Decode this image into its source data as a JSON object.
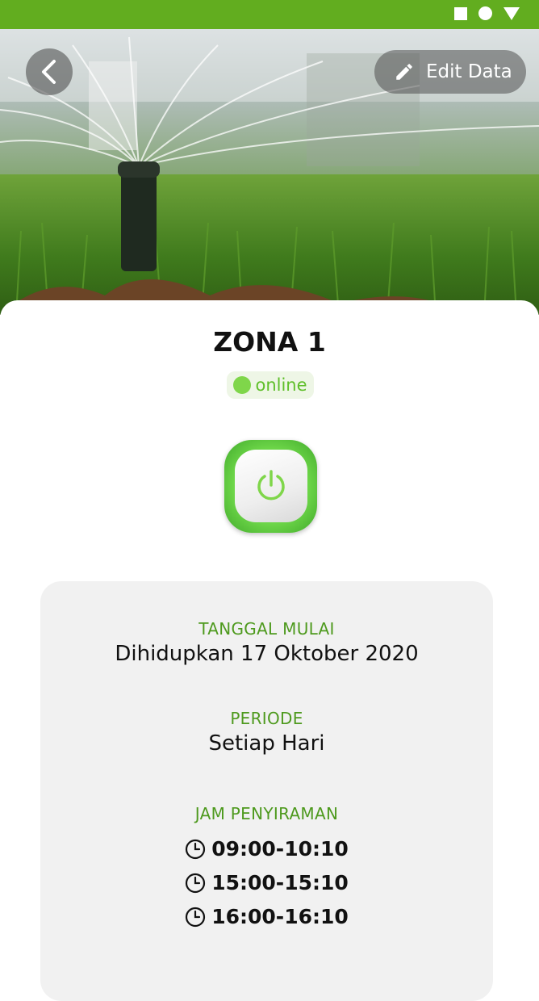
{
  "header": {
    "back_icon": "chevron-left-icon",
    "edit_label": "Edit Data",
    "edit_icon": "pencil-icon",
    "hero_image": "lawn sprinkler watering grass"
  },
  "status_bar": {
    "icons": [
      "square-icon",
      "circle-icon",
      "triangle-down-icon"
    ]
  },
  "zone": {
    "title": "ZONA 1",
    "status": "online"
  },
  "power": {
    "icon": "power-icon",
    "state": "on"
  },
  "info": {
    "start_label": "TANGGAL MULAI",
    "start_value": "Dihidupkan 17 Oktober 2020",
    "period_label": "PERIODE",
    "period_value": "Setiap Hari",
    "schedule_label": "JAM PENYIRAMAN",
    "schedule": [
      "09:00-10:10",
      "15:00-15:10",
      "16:00-16:10"
    ]
  },
  "colors": {
    "brand_green": "#62ad1f",
    "label_green": "#4e9a1e",
    "online_green": "#7fd64a",
    "card_bg": "#f1f1f1"
  }
}
